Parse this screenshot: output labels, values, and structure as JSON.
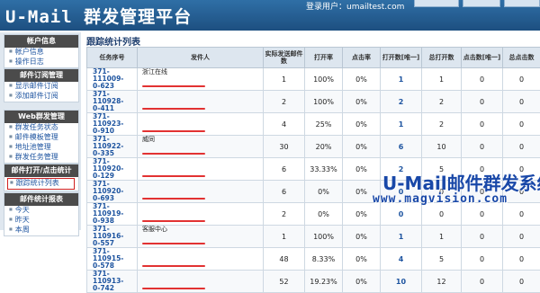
{
  "header": {
    "title": "U-Mail 群发管理平台",
    "login_text": "登录用户：umailtest.com"
  },
  "sidebar": {
    "sections": [
      {
        "title": "帐户信息",
        "items": [
          "帐户信息",
          "操作日志"
        ]
      },
      {
        "title": "邮件订阅管理",
        "items": [
          "显示邮件订阅",
          "添加邮件订阅"
        ]
      },
      {
        "title": "Web群发管理",
        "items": [
          "群发任务状态",
          "邮件模板管理",
          "地址池管理",
          "群发任务管理"
        ]
      },
      {
        "title": "邮件打开/点击统计",
        "items": [
          "跟踪统计列表"
        ],
        "active_item": "跟踪统计列表"
      },
      {
        "title": "邮件统计报表",
        "items": [
          "今天",
          "昨天",
          "本周"
        ]
      }
    ]
  },
  "main": {
    "title": "跟踪统计列表",
    "columns": [
      "任务序号",
      "发件人",
      "实际发送邮件数",
      "打开率",
      "点击率",
      "打开数[唯一]",
      "总打开数",
      "点击数[唯一]",
      "总点击数"
    ],
    "rows": [
      {
        "id": "371-111009-\n0-623",
        "sender": "浙江在线",
        "sent": "1",
        "open_rate": "100%",
        "click_rate": "0%",
        "opens_unique": "1",
        "opens_total": "1",
        "clicks_unique": "0",
        "clicks_total": "0"
      },
      {
        "id": "371-110928-\n0-411",
        "sender": "",
        "sent": "2",
        "open_rate": "100%",
        "click_rate": "0%",
        "opens_unique": "2",
        "opens_total": "2",
        "clicks_unique": "0",
        "clicks_total": "0"
      },
      {
        "id": "371-110923-\n0-910",
        "sender": "",
        "sent": "4",
        "open_rate": "25%",
        "click_rate": "0%",
        "opens_unique": "1",
        "opens_total": "2",
        "clicks_unique": "0",
        "clicks_total": "0"
      },
      {
        "id": "371-110922-\n0-335",
        "sender": "威同",
        "sent": "30",
        "open_rate": "20%",
        "click_rate": "0%",
        "opens_unique": "6",
        "opens_total": "10",
        "clicks_unique": "0",
        "clicks_total": "0"
      },
      {
        "id": "371-110920-\n0-129",
        "sender": "",
        "sent": "6",
        "open_rate": "33.33%",
        "click_rate": "0%",
        "opens_unique": "2",
        "opens_total": "5",
        "clicks_unique": "0",
        "clicks_total": "0"
      },
      {
        "id": "371-110920-\n0-693",
        "sender": "",
        "sent": "6",
        "open_rate": "0%",
        "click_rate": "0%",
        "opens_unique": "0",
        "opens_total": "0",
        "clicks_unique": "0",
        "clicks_total": "0"
      },
      {
        "id": "371-110919-\n0-938",
        "sender": "",
        "sent": "2",
        "open_rate": "0%",
        "click_rate": "0%",
        "opens_unique": "0",
        "opens_total": "0",
        "clicks_unique": "0",
        "clicks_total": "0"
      },
      {
        "id": "371-110916-\n0-557",
        "sender": "客服中心",
        "sent": "1",
        "open_rate": "100%",
        "click_rate": "0%",
        "opens_unique": "1",
        "opens_total": "1",
        "clicks_unique": "0",
        "clicks_total": "0"
      },
      {
        "id": "371-110915-\n0-578",
        "sender": "",
        "sent": "48",
        "open_rate": "8.33%",
        "click_rate": "0%",
        "opens_unique": "4",
        "opens_total": "5",
        "clicks_unique": "0",
        "clicks_total": "0"
      },
      {
        "id": "371-110913-\n0-742",
        "sender": "",
        "sent": "52",
        "open_rate": "19.23%",
        "click_rate": "0%",
        "opens_unique": "10",
        "opens_total": "12",
        "clicks_unique": "0",
        "clicks_total": "0"
      }
    ]
  },
  "watermark": {
    "line1": "U-Mail邮件群发系统",
    "line2": "www.magvision.com"
  },
  "colors": {
    "header_bg": "#2663a0",
    "section_title_bg": "#4b4b4b",
    "link": "#1f55a0",
    "highlight_border": "#d02020",
    "watermark": "#1948a8"
  }
}
